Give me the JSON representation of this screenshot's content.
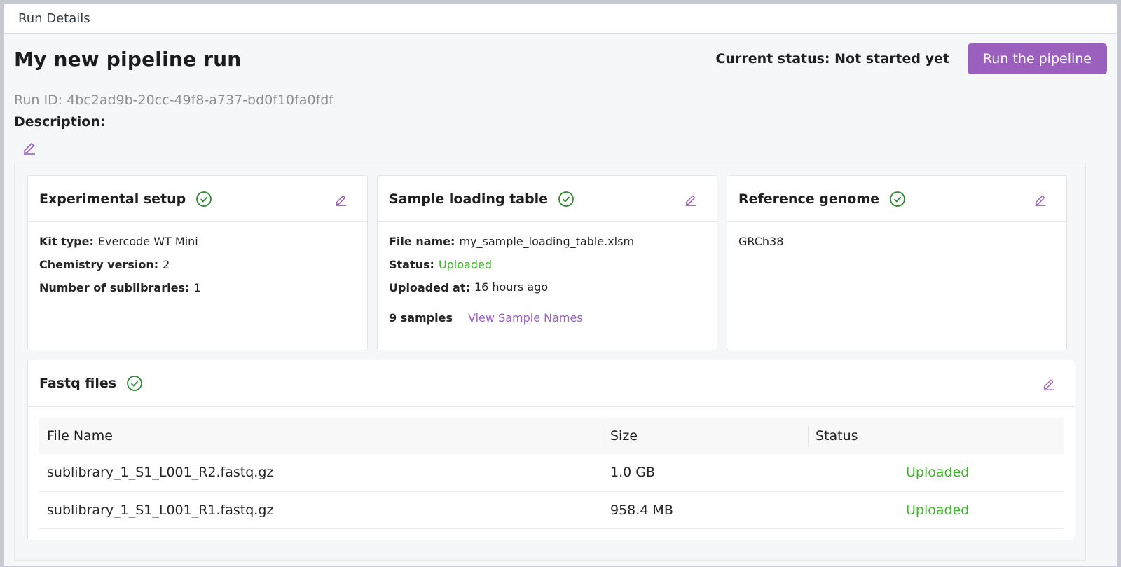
{
  "window": {
    "title": "Run Details"
  },
  "header": {
    "title": "My new pipeline run",
    "status_text": "Current status: Not started yet",
    "run_button_label": "Run the pipeline"
  },
  "run": {
    "id_text": "Run ID: 4bc2ad9b-20cc-49f8-a737-bd0f10fa0fdf",
    "description_label": "Description:"
  },
  "experimental_setup": {
    "title": "Experimental setup",
    "kit_type_label": "Kit type:",
    "kit_type_value": "Evercode WT Mini",
    "chemistry_label": "Chemistry version:",
    "chemistry_value": "2",
    "sublibraries_label": "Number of sublibraries:",
    "sublibraries_value": "1"
  },
  "sample_loading": {
    "title": "Sample loading table",
    "file_name_label": "File name:",
    "file_name_value": "my_sample_loading_table.xlsm",
    "status_label": "Status:",
    "status_value": "Uploaded",
    "uploaded_at_label": "Uploaded at:",
    "uploaded_at_value": "16 hours ago",
    "samples_count": "9 samples",
    "view_names_link": "View Sample Names"
  },
  "reference_genome": {
    "title": "Reference genome",
    "value": "GRCh38"
  },
  "fastq": {
    "title": "Fastq files",
    "columns": [
      "File Name",
      "Size",
      "Status"
    ],
    "rows": [
      {
        "name": "sublibrary_1_S1_L001_R2.fastq.gz",
        "size": "1.0 GB",
        "status": "Uploaded"
      },
      {
        "name": "sublibrary_1_S1_L001_R1.fastq.gz",
        "size": "958.4 MB",
        "status": "Uploaded"
      }
    ]
  },
  "colors": {
    "accent": "#9b5fbd",
    "success": "#3fb52a",
    "check": "#2e8b2e"
  },
  "icons": {
    "edit": "pencil-icon",
    "complete": "check-circle-icon"
  }
}
